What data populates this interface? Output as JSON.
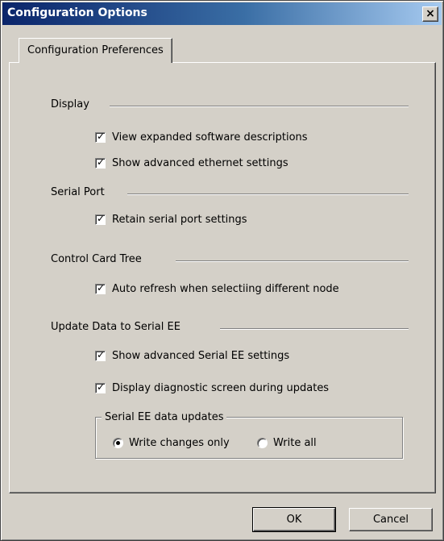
{
  "window": {
    "title": "Configuration Options",
    "close_symbol": "×"
  },
  "tabs": [
    {
      "label": "Configuration Preferences",
      "active": true
    }
  ],
  "sections": {
    "display": {
      "title": "Display",
      "options": [
        {
          "label": "View expanded software descriptions",
          "checked": true
        },
        {
          "label": "Show advanced ethernet settings",
          "checked": true
        }
      ]
    },
    "serial_port": {
      "title": "Serial Port",
      "options": [
        {
          "label": "Retain serial port settings",
          "checked": true
        }
      ]
    },
    "control_card_tree": {
      "title": "Control Card Tree",
      "options": [
        {
          "label": "Auto refresh when selectiing different node",
          "checked": true
        }
      ]
    },
    "update_data": {
      "title": "Update Data to Serial EE",
      "options": [
        {
          "label": "Show advanced Serial EE settings",
          "checked": true
        },
        {
          "label": "Display diagnostic screen during updates",
          "checked": true
        }
      ],
      "group": {
        "title": "Serial EE data updates",
        "radios": [
          {
            "label": "Write changes only",
            "selected": true
          },
          {
            "label": "Write all",
            "selected": false
          }
        ]
      }
    }
  },
  "buttons": {
    "ok": "OK",
    "cancel": "Cancel"
  },
  "check_mark": "✓",
  "colors": {
    "dialog_bg": "#d4d0c8",
    "title_start": "#0a246a",
    "title_end": "#a6caf0"
  }
}
